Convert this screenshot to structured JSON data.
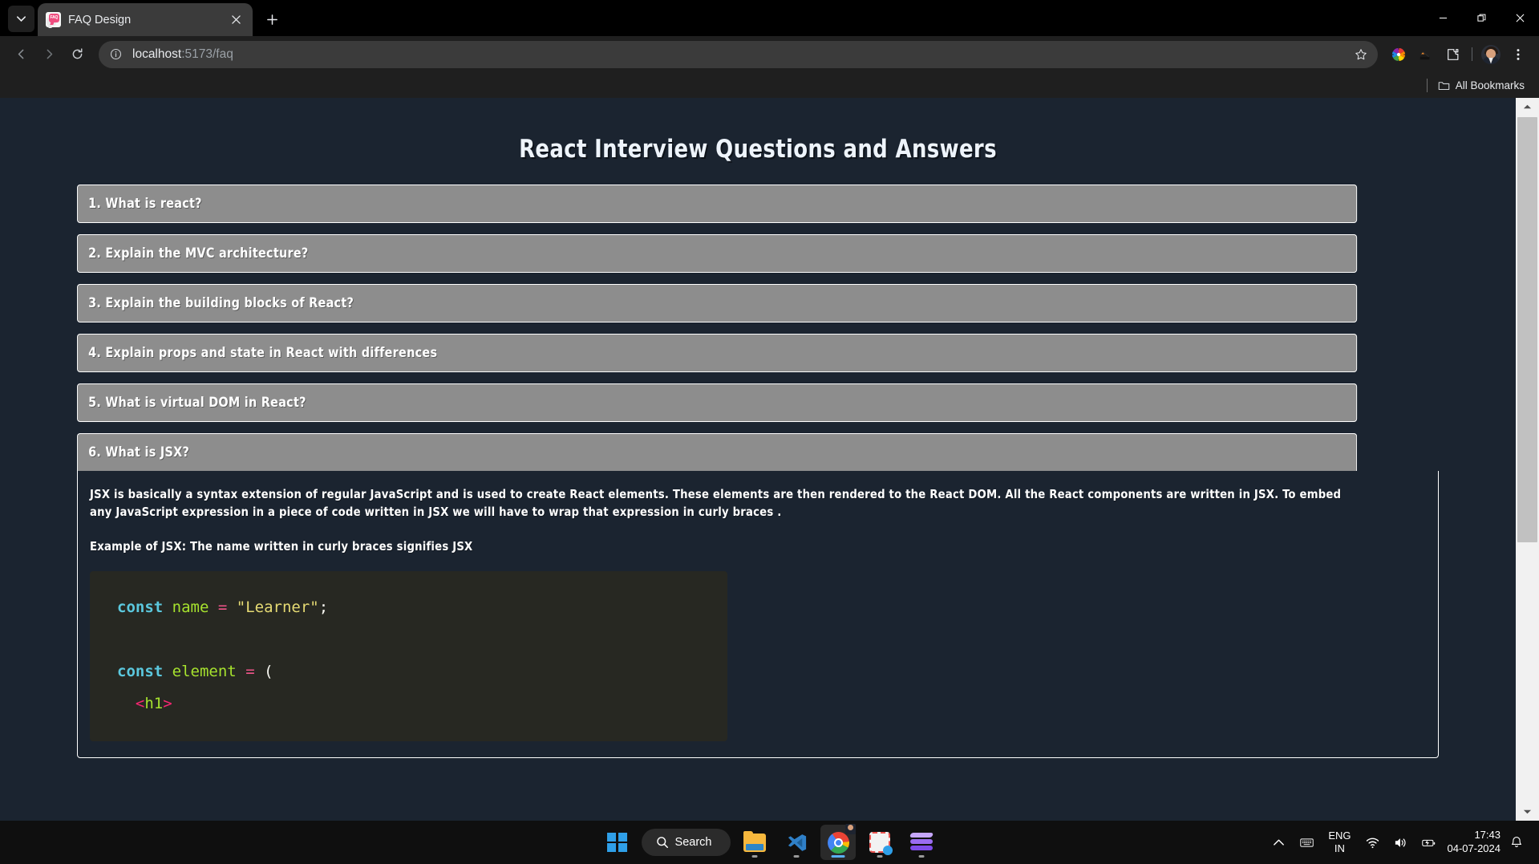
{
  "browser": {
    "tab": {
      "title": "FAQ Design",
      "favicon": "faq-bubble-icon",
      "favicon_text": "FAQ"
    },
    "new_tab_label": "+",
    "url_host": "localhost",
    "url_rest": ":5173/faq",
    "window_controls": {
      "minimize": "minimize-icon",
      "maximize": "restore-icon",
      "close": "close-icon"
    },
    "toolbar_icons": [
      "back-icon",
      "forward-icon",
      "reload-icon",
      "site-info-icon",
      "bookmark-star-icon",
      "color-picker-extension-icon",
      "extension-icon",
      "extensions-puzzle-icon",
      "profile-avatar",
      "chrome-menu-icon"
    ],
    "bookmarks": {
      "folder_icon": "folder-icon",
      "label": "All Bookmarks"
    }
  },
  "page": {
    "title": "React Interview Questions and Answers",
    "faq": [
      {
        "n": 1,
        "question": "1. What is react?",
        "open": false
      },
      {
        "n": 2,
        "question": "2. Explain the MVC architecture?",
        "open": false
      },
      {
        "n": 3,
        "question": "3. Explain the building blocks of React?",
        "open": false
      },
      {
        "n": 4,
        "question": "4. Explain props and state in React with differences",
        "open": false
      },
      {
        "n": 5,
        "question": "5. What is virtual DOM in React?",
        "open": false
      },
      {
        "n": 6,
        "question": "6. What is JSX?",
        "open": true,
        "answer_p1": "JSX is basically a syntax extension of regular JavaScript and is used to create React elements. These elements are then rendered to the React DOM. All the React components are written in JSX. To embed any JavaScript expression in a piece of code written in JSX we will have to wrap that expression in curly braces .",
        "answer_p2": "Example of JSX: The name written in curly braces signifies JSX",
        "code": {
          "line1_keyword": "const",
          "line1_var": "name",
          "line1_op": "=",
          "line1_str": "\"Learner\"",
          "line1_semi": ";",
          "line2_keyword": "const",
          "line2_var": "element",
          "line2_op": "=",
          "line2_paren": "(",
          "line3_open": "<",
          "line3_tag": "h1",
          "line3_close": ">"
        }
      }
    ]
  },
  "colors": {
    "page_bg": "#1b2430",
    "question_bg": "#8d8d8d",
    "question_border": "#ffffff",
    "text": "#ffffff",
    "code_bg": "#272822",
    "code_keyword": "#5bc8de",
    "code_variable": "#a6e22e",
    "code_operator": "#f0558a",
    "code_string": "#e6db74",
    "code_bracket": "#f92672"
  },
  "taskbar": {
    "start": "windows-logo-icon",
    "search_label": "Search",
    "apps": [
      "file-explorer-icon",
      "vscode-icon",
      "chrome-icon",
      "snipping-tool-icon",
      "clipchamp-icon"
    ],
    "tray": {
      "overflow": "chevron-up-icon",
      "keyboard": "keyboard-icon",
      "language_1": "ENG",
      "language_2": "IN",
      "wifi": "wifi-icon",
      "volume": "volume-icon",
      "battery": "battery-icon",
      "time": "17:43",
      "date": "04-07-2024",
      "notifications": "bell-icon"
    }
  }
}
